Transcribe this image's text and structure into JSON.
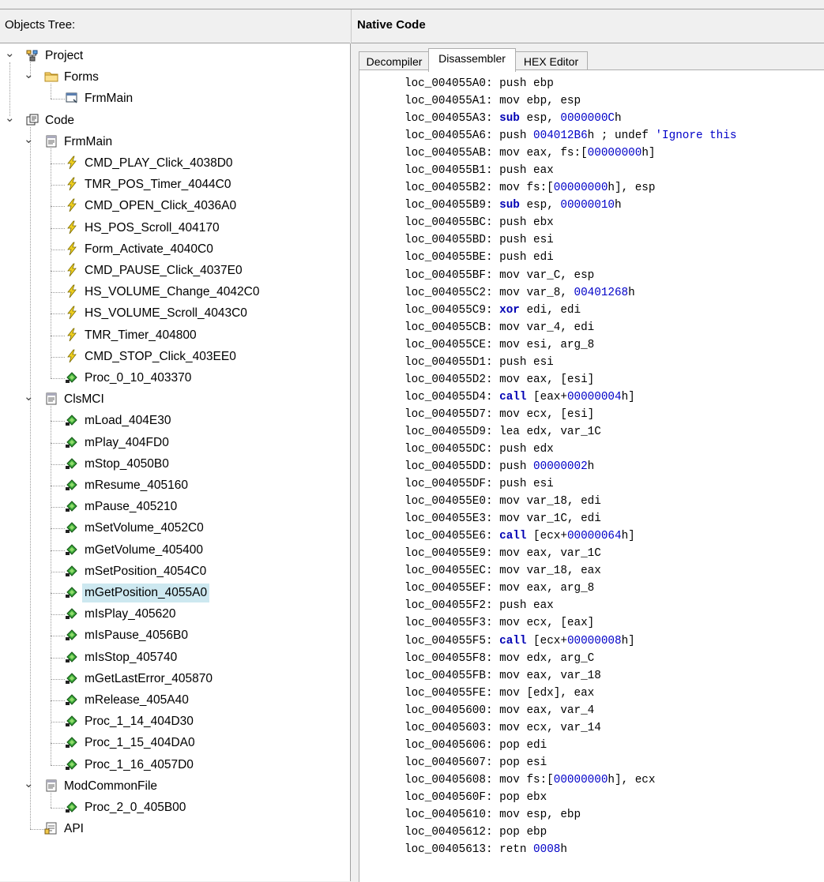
{
  "headers": {
    "objects_tree": "Objects Tree:",
    "native_code": "Native Code"
  },
  "tabs": [
    "Decompiler",
    "Disassembler",
    "HEX Editor"
  ],
  "active_tab": "Disassembler",
  "tree": {
    "project": "Project",
    "forms": "Forms",
    "frmmain_form": "FrmMain",
    "code": "Code",
    "frmmain": "FrmMain",
    "frmmain_items": [
      "CMD_PLAY_Click_4038D0",
      "TMR_POS_Timer_4044C0",
      "CMD_OPEN_Click_4036A0",
      "HS_POS_Scroll_404170",
      "Form_Activate_4040C0",
      "CMD_PAUSE_Click_4037E0",
      "HS_VOLUME_Change_4042C0",
      "HS_VOLUME_Scroll_4043C0",
      "TMR_Timer_404800",
      "CMD_STOP_Click_403EE0"
    ],
    "frmmain_proc": "Proc_0_10_403370",
    "clsmci": "ClsMCI",
    "clsmci_items": [
      "mLoad_404E30",
      "mPlay_404FD0",
      "mStop_4050B0",
      "mResume_405160",
      "mPause_405210",
      "mSetVolume_4052C0",
      "mGetVolume_405400",
      "mSetPosition_4054C0",
      "mGetPosition_4055A0",
      "mIsPlay_405620",
      "mIsPause_4056B0",
      "mIsStop_405740",
      "mGetLastError_405870",
      "mRelease_405A40",
      "Proc_1_14_404D30",
      "Proc_1_15_404DA0",
      "Proc_1_16_4057D0"
    ],
    "selected": "mGetPosition_4055A0",
    "modcommonfile": "ModCommonFile",
    "mod_items": [
      "Proc_2_0_405B00"
    ],
    "api": "API"
  },
  "code_lines": [
    [
      [
        "loc_004055A0: ",
        ""
      ],
      [
        "push",
        "t"
      ],
      [
        " ebp",
        "t"
      ]
    ],
    [
      [
        "loc_004055A1: ",
        ""
      ],
      [
        "mov ebp, esp",
        ""
      ]
    ],
    [
      [
        "loc_004055A3: ",
        ""
      ],
      [
        "sub",
        "kw"
      ],
      [
        " esp, ",
        ""
      ],
      [
        "0000000C",
        "num"
      ],
      [
        "h",
        ""
      ]
    ],
    [
      [
        "loc_004055A6: ",
        ""
      ],
      [
        "push ",
        ""
      ],
      [
        "004012B6",
        "num"
      ],
      [
        "h ; undef ",
        ""
      ],
      [
        "'Ignore this",
        "str"
      ]
    ],
    [
      [
        "loc_004055AB: ",
        ""
      ],
      [
        "mov eax, fs:[",
        ""
      ],
      [
        "00000000",
        "num"
      ],
      [
        "h]",
        ""
      ]
    ],
    [
      [
        "loc_004055B1: ",
        ""
      ],
      [
        "push eax",
        ""
      ]
    ],
    [
      [
        "loc_004055B2: ",
        ""
      ],
      [
        "mov fs:[",
        ""
      ],
      [
        "00000000",
        "num"
      ],
      [
        "h], esp",
        ""
      ]
    ],
    [
      [
        "loc_004055B9: ",
        ""
      ],
      [
        "sub",
        "kw"
      ],
      [
        " esp, ",
        ""
      ],
      [
        "00000010",
        "num"
      ],
      [
        "h",
        ""
      ]
    ],
    [
      [
        "loc_004055BC: ",
        ""
      ],
      [
        "push ebx",
        ""
      ]
    ],
    [
      [
        "loc_004055BD: ",
        ""
      ],
      [
        "push esi",
        ""
      ]
    ],
    [
      [
        "loc_004055BE: ",
        ""
      ],
      [
        "push edi",
        ""
      ]
    ],
    [
      [
        "loc_004055BF: ",
        ""
      ],
      [
        "mov var_C, esp",
        ""
      ]
    ],
    [
      [
        "loc_004055C2: ",
        ""
      ],
      [
        "mov var_8, ",
        ""
      ],
      [
        "00401268",
        "num"
      ],
      [
        "h",
        ""
      ]
    ],
    [
      [
        "loc_004055C9: ",
        ""
      ],
      [
        "xor",
        "kw"
      ],
      [
        " edi, edi",
        ""
      ]
    ],
    [
      [
        "loc_004055CB: ",
        ""
      ],
      [
        "mov var_4, edi",
        ""
      ]
    ],
    [
      [
        "loc_004055CE: ",
        ""
      ],
      [
        "mov esi, arg_8",
        ""
      ]
    ],
    [
      [
        "loc_004055D1: ",
        ""
      ],
      [
        "push esi",
        ""
      ]
    ],
    [
      [
        "loc_004055D2: ",
        ""
      ],
      [
        "mov eax, [esi]",
        ""
      ]
    ],
    [
      [
        "loc_004055D4: ",
        ""
      ],
      [
        "call",
        "kw"
      ],
      [
        " [eax+",
        ""
      ],
      [
        "00000004",
        "num"
      ],
      [
        "h]",
        ""
      ]
    ],
    [
      [
        "loc_004055D7: ",
        ""
      ],
      [
        "mov ecx, [esi]",
        ""
      ]
    ],
    [
      [
        "loc_004055D9: ",
        ""
      ],
      [
        "lea edx, var_1C",
        ""
      ]
    ],
    [
      [
        "loc_004055DC: ",
        ""
      ],
      [
        "push edx",
        ""
      ]
    ],
    [
      [
        "loc_004055DD: ",
        ""
      ],
      [
        "push ",
        ""
      ],
      [
        "00000002",
        "num"
      ],
      [
        "h",
        ""
      ]
    ],
    [
      [
        "loc_004055DF: ",
        ""
      ],
      [
        "push esi",
        ""
      ]
    ],
    [
      [
        "loc_004055E0: ",
        ""
      ],
      [
        "mov var_18, edi",
        ""
      ]
    ],
    [
      [
        "loc_004055E3: ",
        ""
      ],
      [
        "mov var_1C, edi",
        ""
      ]
    ],
    [
      [
        "loc_004055E6: ",
        ""
      ],
      [
        "call",
        "kw"
      ],
      [
        " [ecx+",
        ""
      ],
      [
        "00000064",
        "num"
      ],
      [
        "h]",
        ""
      ]
    ],
    [
      [
        "loc_004055E9: ",
        ""
      ],
      [
        "mov eax, var_1C",
        ""
      ]
    ],
    [
      [
        "loc_004055EC: ",
        ""
      ],
      [
        "mov var_18, eax",
        ""
      ]
    ],
    [
      [
        "loc_004055EF: ",
        ""
      ],
      [
        "mov eax, arg_8",
        ""
      ]
    ],
    [
      [
        "loc_004055F2: ",
        ""
      ],
      [
        "push eax",
        ""
      ]
    ],
    [
      [
        "loc_004055F3: ",
        ""
      ],
      [
        "mov ecx, [eax]",
        ""
      ]
    ],
    [
      [
        "loc_004055F5: ",
        ""
      ],
      [
        "call",
        "kw"
      ],
      [
        " [ecx+",
        ""
      ],
      [
        "00000008",
        "num"
      ],
      [
        "h]",
        ""
      ]
    ],
    [
      [
        "loc_004055F8: ",
        ""
      ],
      [
        "mov edx, arg_C",
        ""
      ]
    ],
    [
      [
        "loc_004055FB: ",
        ""
      ],
      [
        "mov eax, var_18",
        ""
      ]
    ],
    [
      [
        "loc_004055FE: ",
        ""
      ],
      [
        "mov [edx], eax",
        ""
      ]
    ],
    [
      [
        "loc_00405600: ",
        ""
      ],
      [
        "mov eax, var_4",
        ""
      ]
    ],
    [
      [
        "loc_00405603: ",
        ""
      ],
      [
        "mov ecx, var_14",
        ""
      ]
    ],
    [
      [
        "loc_00405606: ",
        ""
      ],
      [
        "pop edi",
        ""
      ]
    ],
    [
      [
        "loc_00405607: ",
        ""
      ],
      [
        "pop esi",
        ""
      ]
    ],
    [
      [
        "loc_00405608: ",
        ""
      ],
      [
        "mov fs:[",
        ""
      ],
      [
        "00000000",
        "num"
      ],
      [
        "h], ecx",
        ""
      ]
    ],
    [
      [
        "loc_0040560F: ",
        ""
      ],
      [
        "pop ebx",
        ""
      ]
    ],
    [
      [
        "loc_00405610: ",
        ""
      ],
      [
        "mov esp, ebp",
        ""
      ]
    ],
    [
      [
        "loc_00405612: ",
        ""
      ],
      [
        "pop ebp",
        ""
      ]
    ],
    [
      [
        "loc_00405613: ",
        ""
      ],
      [
        "retn ",
        ""
      ],
      [
        "0008",
        "num"
      ],
      [
        "h",
        ""
      ]
    ]
  ],
  "colors": {
    "keyword": "#0000b4",
    "number": "#0000c8",
    "selection": "#cde8f0"
  },
  "icons": {
    "project": "project-icon",
    "folder": "folder-icon",
    "form": "form-icon",
    "code": "code-icon",
    "module": "module-icon",
    "event": "lightning-icon",
    "method": "green-method-icon",
    "api": "api-icon"
  }
}
